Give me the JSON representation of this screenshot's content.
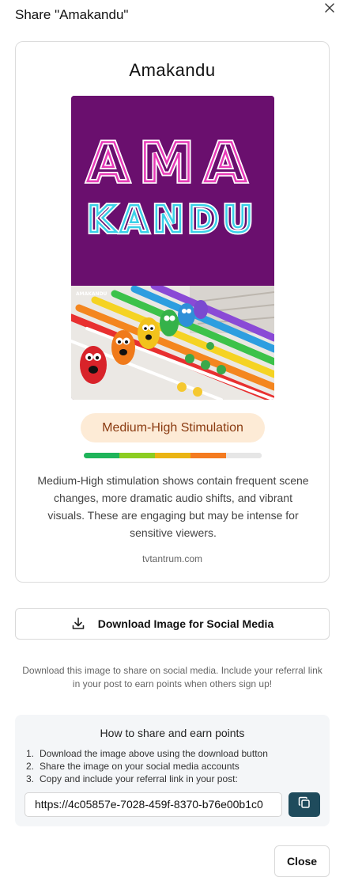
{
  "modal": {
    "title": "Share \"Amakandu\"",
    "close_button": "Close"
  },
  "card": {
    "show_title": "Amakandu",
    "poster": {
      "logo_line1": "AMA",
      "logo_line2": "KANDU",
      "corner_text": "AMAKANDU"
    },
    "stimulation": {
      "level_label": "Medium-High Stimulation",
      "level_fraction": 0.8,
      "segment_colors": [
        "#1fb45a",
        "#8ccd22",
        "#eab413",
        "#f47b20",
        "#e6e6e6"
      ],
      "description": "Medium-High stimulation shows contain frequent scene changes, more dramatic audio shifts, and vibrant visuals. These are engaging but may be intense for sensitive viewers."
    },
    "site": "tvtantrum.com"
  },
  "download": {
    "label": "Download Image for Social Media",
    "hint": "Download this image to share on social media. Include your referral link in your post to earn points when others sign up!"
  },
  "howto": {
    "title": "How to share and earn points",
    "steps": [
      "Download the image above using the download button",
      "Share the image on your social media accounts",
      "Copy and include your referral link in your post:"
    ],
    "referral_link": "https://4c05857e-7028-459f-8370-b76e00b1c0"
  },
  "icons": {
    "close": "close-icon",
    "download": "download-icon",
    "copy": "copy-icon"
  },
  "colors": {
    "badge_bg": "#fdebd6",
    "badge_text": "#8a3a10",
    "copy_button": "#1f4b5c",
    "poster_bg": "#6a0f6e"
  }
}
